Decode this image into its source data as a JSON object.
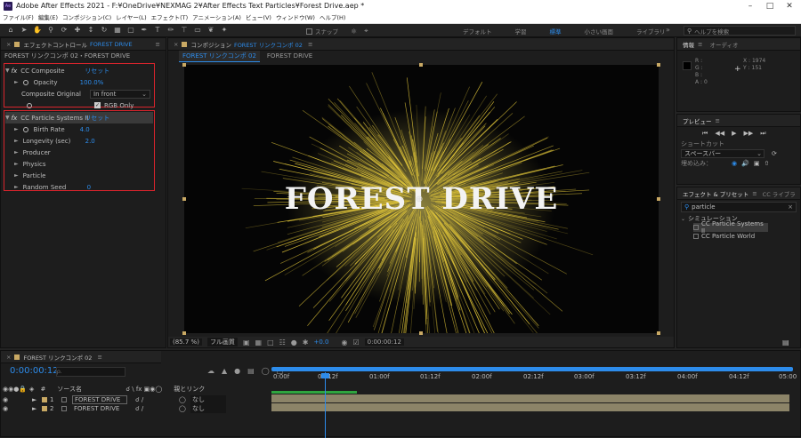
{
  "window": {
    "title": "Adobe After Effects 2021 - F:¥OneDrive¥NEXMAG 2¥After Effects Text Particles¥Forest Drive.aep *",
    "app_icon": "Ae"
  },
  "menu": [
    "ファイル(F)",
    "編集(E)",
    "コンポジション(C)",
    "レイヤー(L)",
    "エフェクト(T)",
    "アニメーション(A)",
    "ビュー(V)",
    "ウィンドウ(W)",
    "ヘルプ(H)"
  ],
  "toolbar": {
    "snap_label": "スナップ",
    "workspaces": [
      "デフォルト",
      "学習",
      "標準",
      "小さい画面",
      "ライブラリ"
    ],
    "active_workspace": "標準",
    "help_search_placeholder": "ヘルプを検索"
  },
  "effect_controls": {
    "tab_prefix": "エフェクトコントロール",
    "tab_layer": "FOREST DRIVE",
    "layer_path": "FOREST リンクコンポ 02・FOREST DRIVE",
    "composite": {
      "name": "CC Composite",
      "reset": "リセット",
      "opacity_label": "Opacity",
      "opacity_value": "100.0%",
      "original_label": "Composite Original",
      "original_value": "In front",
      "rgb_only_label": "RGB Only"
    },
    "particle": {
      "name": "CC Particle Systems II",
      "reset": "リセット",
      "birth_rate_label": "Birth Rate",
      "birth_rate_value": "4.0",
      "longevity_label": "Longevity (sec)",
      "longevity_value": "2.0",
      "producer": "Producer",
      "physics": "Physics",
      "particle": "Particle",
      "random_seed_label": "Random Seed",
      "random_seed_value": "0"
    }
  },
  "composition": {
    "tab_prefix": "コンポジション",
    "tab_name": "FOREST リンクコンポ 02",
    "subtab_active": "FOREST リンクコンポ 02",
    "subtab_other": "FOREST DRIVE",
    "headline": "FOREST DRIVE",
    "zoom": "(85.7 %)",
    "quality": "フル画質",
    "exposure": "+0.0",
    "timecode": "0:00:00:12"
  },
  "info_panel": {
    "tab": "情報",
    "audio_tab": "オーディオ",
    "r": "R :",
    "g": "G :",
    "b": "B :",
    "a": "A :   0",
    "x": "X : 1974",
    "y": "Y : 151"
  },
  "preview_panel": {
    "tab": "プレビュー",
    "shortcut_label": "ショートカット",
    "shortcut_value": "スペースバー",
    "include_label": "埋め込み："
  },
  "effects_presets": {
    "tab": "エフェクト & プリセット",
    "cc_tab": "CC ライブラ",
    "search_value": "particle",
    "category": "シミュレーション",
    "items": [
      "CC Particle Systems II",
      "CC Particle World"
    ]
  },
  "timeline": {
    "tab_name": "FOREST リンクコンポ 02",
    "timecode": "0:00:00:12",
    "search_placeholder": "ρ.",
    "col_source": "ソース名",
    "col_parent": "親とリンク",
    "ruler": [
      "0:00f",
      "00:12f",
      "01:00f",
      "01:12f",
      "02:00f",
      "02:12f",
      "03:00f",
      "03:12f",
      "04:00f",
      "04:12f",
      "05:00"
    ],
    "layers": [
      {
        "num": "1",
        "name": "FOREST DRIVE",
        "parent": "なし"
      },
      {
        "num": "2",
        "name": "FOREST DRIVE",
        "parent": "なし"
      }
    ]
  }
}
